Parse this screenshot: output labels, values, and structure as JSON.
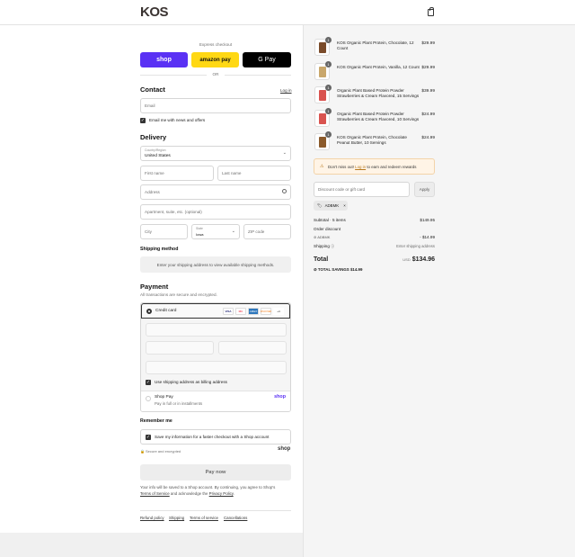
{
  "header": {
    "logo": "KOS"
  },
  "express": {
    "label": "Express checkout",
    "shop_label": "shop",
    "amazon_label": "amazon pay",
    "gpay_label": "G Pay",
    "or_label": "OR"
  },
  "contact": {
    "title": "Contact",
    "login_link": "Log in",
    "email_placeholder": "Email",
    "news_label": "Email me with news and offers"
  },
  "delivery": {
    "title": "Delivery",
    "country_label": "Country/Region",
    "country_value": "United States",
    "first_name": "First name",
    "last_name": "Last name",
    "address": "Address",
    "apartment": "Apartment, suite, etc. (optional)",
    "city": "City",
    "state_label": "State",
    "state_value": "Iowa",
    "zip": "ZIP code"
  },
  "shipping": {
    "title": "Shipping method",
    "message": "Enter your shipping address to view available shipping methods."
  },
  "payment": {
    "title": "Payment",
    "subtitle": "All transactions are secure and encrypted.",
    "credit_card_label": "Credit card",
    "card_icons": [
      "VISA",
      "MC",
      "AMEX",
      "DISCOVER",
      "+4"
    ],
    "billing_label": "Use shipping address as billing address",
    "shoppay_label": "Shop Pay",
    "shoppay_sub": "Pay in full or in installments",
    "shoppay_brand": "shop"
  },
  "remember": {
    "title": "Remember me",
    "save_label": "Save my information for a faster checkout with a Shop account",
    "secure_label": "Secure and encrypted",
    "shop_brand": "shop"
  },
  "pay_now": "Pay now",
  "terms": {
    "line1": "Your info will be saved to a Shop account. By continuing, you agree to Shop's",
    "tos": "Terms of Service",
    "mid": " and acknowledge the ",
    "privacy": "Privacy Policy",
    "end": "."
  },
  "policies": [
    "Refund policy",
    "Shipping",
    "Terms of service",
    "Cancellations"
  ],
  "cart": {
    "items": [
      {
        "qty": "1",
        "name": "KOS Organic Plant Protein, Chocolate, 12 Count",
        "price": "$29.99",
        "color": "#7a4b2a"
      },
      {
        "qty": "1",
        "name": "KOS Organic Plant Protein, Vanilla, 12 Count",
        "price": "$29.99",
        "color": "#c9a76b"
      },
      {
        "qty": "1",
        "name": "Organic Plant Based Protein Powder Strawberries & Cream Flavored, 15 Servings",
        "price": "$39.99",
        "color": "#d9534f"
      },
      {
        "qty": "1",
        "name": "Organic Plant Based Protein Powder Strawberries & Cream Flavored, 10 Servings",
        "price": "$24.99",
        "color": "#d9534f"
      },
      {
        "qty": "1",
        "name": "KOS Organic Plant Protein, Chocolate Peanut Butter, 10 Servings",
        "price": "$24.99",
        "color": "#8b5a2b"
      }
    ],
    "rewards_text": "Don't miss out!",
    "rewards_link": "Log in",
    "rewards_tail": " to earn and redeem rewards",
    "discount_placeholder": "Discount code or gift card",
    "apply_label": "Apply",
    "code_tag": "ADBMK",
    "subtotal_label": "Subtotal · 5 items",
    "subtotal_value": "$149.95",
    "order_discount_label": "Order discount",
    "discount_code": "ADBMK",
    "discount_value": "- $14.99",
    "shipping_label": "Shipping",
    "shipping_value": "Enter shipping address",
    "total_label": "Total",
    "currency": "USD",
    "total_value": "$134.96",
    "savings_label": "TOTAL SAVINGS",
    "savings_value": "$14.99"
  },
  "colors": {
    "shop": "#5a31f4",
    "amazon": "#ffd814",
    "gpay": "#000000",
    "rewards_bg": "#fff4e6"
  }
}
